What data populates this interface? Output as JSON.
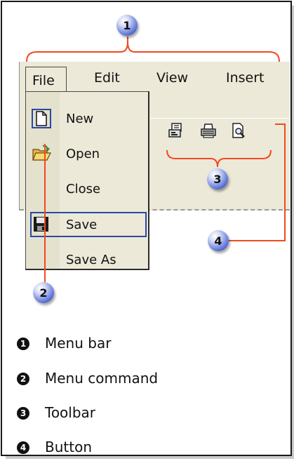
{
  "menubar": {
    "items": [
      {
        "label": "File"
      },
      {
        "label": "Edit"
      },
      {
        "label": "View"
      },
      {
        "label": "Insert"
      }
    ]
  },
  "toolbar": {
    "buttons": [
      {
        "icon": "print-preview-form-icon"
      },
      {
        "icon": "printer-icon"
      },
      {
        "icon": "search-document-icon"
      }
    ]
  },
  "file_menu": {
    "items": [
      {
        "label": "New",
        "icon": "new-document-icon"
      },
      {
        "label": "Open",
        "icon": "open-folder-icon"
      },
      {
        "label": "Close",
        "icon": ""
      },
      {
        "label": "Save",
        "icon": "floppy-disk-icon"
      },
      {
        "label": "Save As",
        "icon": ""
      }
    ]
  },
  "callouts": [
    {
      "number": "1"
    },
    {
      "number": "2"
    },
    {
      "number": "3"
    },
    {
      "number": "4"
    }
  ],
  "legend": [
    {
      "number": "1",
      "text": "Menu bar"
    },
    {
      "number": "2",
      "text": "Menu command"
    },
    {
      "number": "3",
      "text": "Toolbar"
    },
    {
      "number": "4",
      "text": "Button"
    }
  ],
  "colors": {
    "leader_line": "#f04a1f",
    "callout_blue": "#4a63d0",
    "window_face": "#ece9d8",
    "highlight_border": "#2849a8"
  }
}
